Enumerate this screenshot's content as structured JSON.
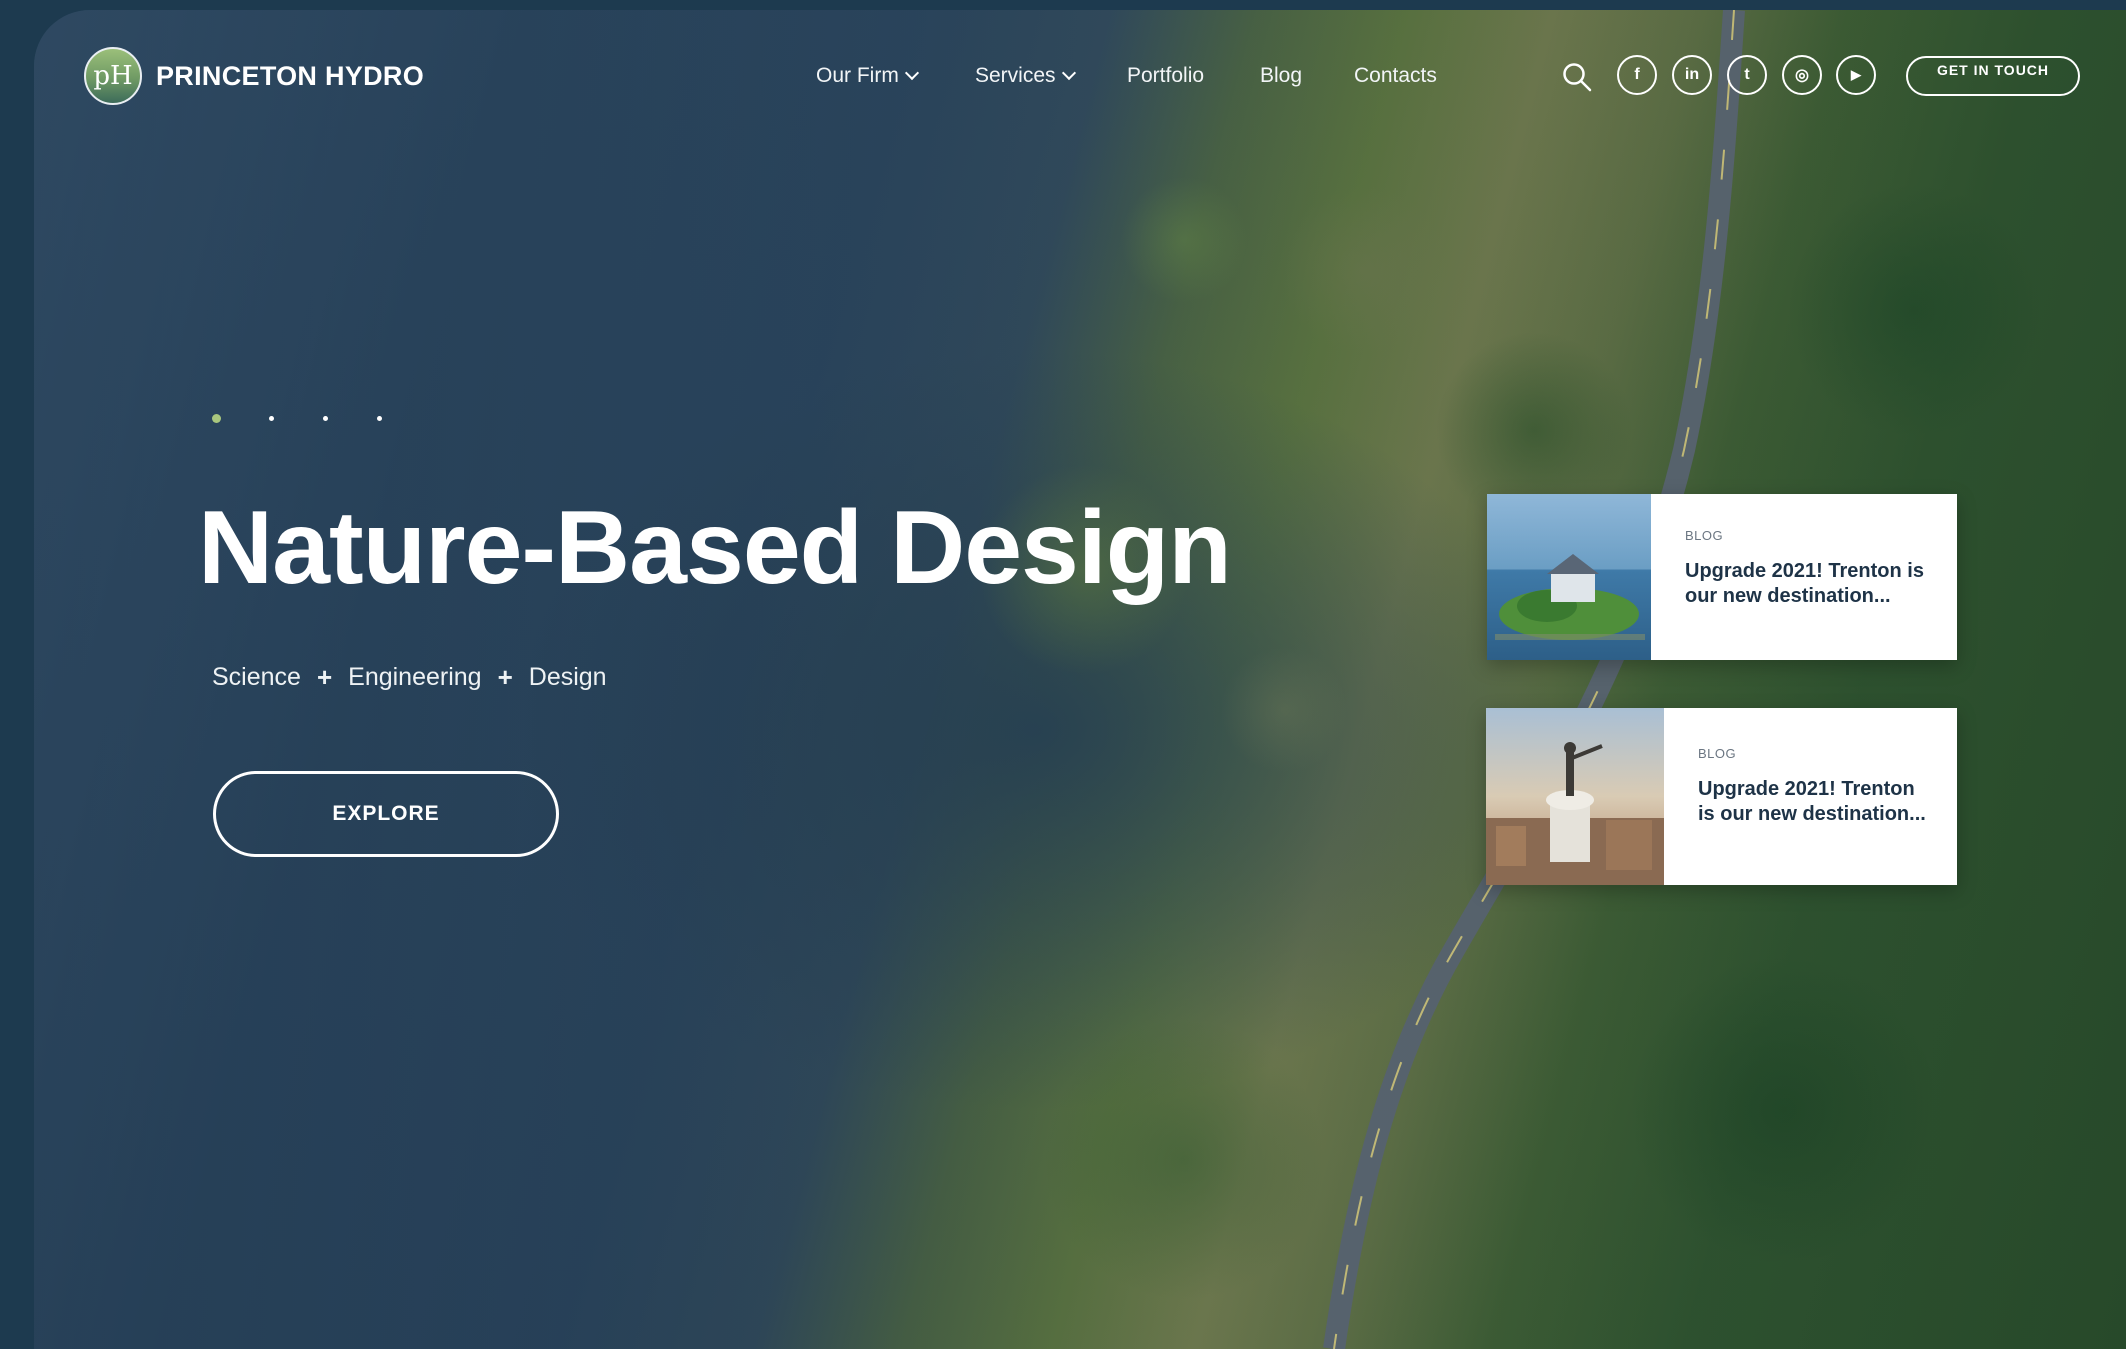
{
  "brand": {
    "logo_mark": "pH",
    "name": "PRINCETON HYDRO"
  },
  "nav": {
    "items": [
      {
        "label": "Our Firm",
        "dropdown": true
      },
      {
        "label": "Services",
        "dropdown": true
      },
      {
        "label": "Portfolio",
        "dropdown": false
      },
      {
        "label": "Blog",
        "dropdown": false
      },
      {
        "label": "Contacts",
        "dropdown": false
      }
    ],
    "search_icon": "search-icon",
    "social": [
      {
        "name": "facebook-icon",
        "glyph": "f"
      },
      {
        "name": "linkedin-icon",
        "glyph": "in"
      },
      {
        "name": "twitter-icon",
        "glyph": "t"
      },
      {
        "name": "instagram-icon",
        "glyph": "◎"
      },
      {
        "name": "youtube-icon",
        "glyph": "▶"
      }
    ],
    "cta_label": "GET IN TOUCH"
  },
  "hero": {
    "slides_total": 4,
    "active_slide": 1,
    "title": "Nature-Based Design",
    "tagline": [
      "Science",
      "Engineering",
      "Design"
    ],
    "tagline_separator": "+",
    "explore_label": "EXPLORE"
  },
  "cards": [
    {
      "tag": "BLOG",
      "title": "Upgrade 2021! Trenton is our new destination..."
    },
    {
      "tag": "BLOG",
      "title": "Upgrade 2021! Trenton is our new destination..."
    }
  ],
  "colors": {
    "accent": "#a9c77e",
    "background": "#1d3a4f",
    "card_title": "#1e3347"
  }
}
